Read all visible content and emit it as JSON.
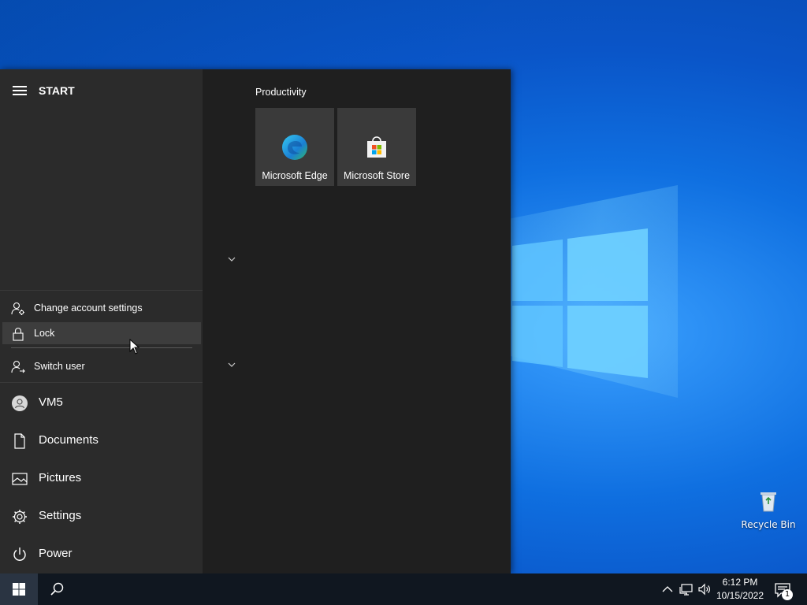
{
  "start_menu": {
    "title": "START",
    "user_flyout": {
      "items": [
        {
          "label": "Change account settings",
          "icon": "person-settings-icon"
        },
        {
          "label": "Lock",
          "icon": "lock-icon"
        },
        {
          "label": "Switch user",
          "icon": "switch-user-icon"
        }
      ]
    },
    "nav": [
      {
        "label": "VM5",
        "icon": "avatar-icon"
      },
      {
        "label": "Documents",
        "icon": "document-icon"
      },
      {
        "label": "Pictures",
        "icon": "pictures-icon"
      },
      {
        "label": "Settings",
        "icon": "gear-icon"
      },
      {
        "label": "Power",
        "icon": "power-icon"
      }
    ],
    "tile_group": {
      "title": "Productivity",
      "tiles": [
        {
          "label": "Microsoft Edge",
          "icon": "edge-icon"
        },
        {
          "label": "Microsoft Store",
          "icon": "store-icon"
        }
      ]
    }
  },
  "desktop": {
    "icons": [
      {
        "label": "Recycle Bin",
        "icon": "recycle-bin-icon"
      }
    ]
  },
  "taskbar": {
    "clock_time": "6:12 PM",
    "clock_date": "10/15/2022",
    "notification_count": "1",
    "tray_icons": [
      "chevron-up-icon",
      "network-icon",
      "volume-icon"
    ]
  },
  "colors": {
    "desktop_blue": "#0a55c8",
    "start_bg": "#1f1f1f",
    "left_pane": "#2b2b2b",
    "tile_bg": "#3a3a3a",
    "taskbar": "#101720"
  }
}
